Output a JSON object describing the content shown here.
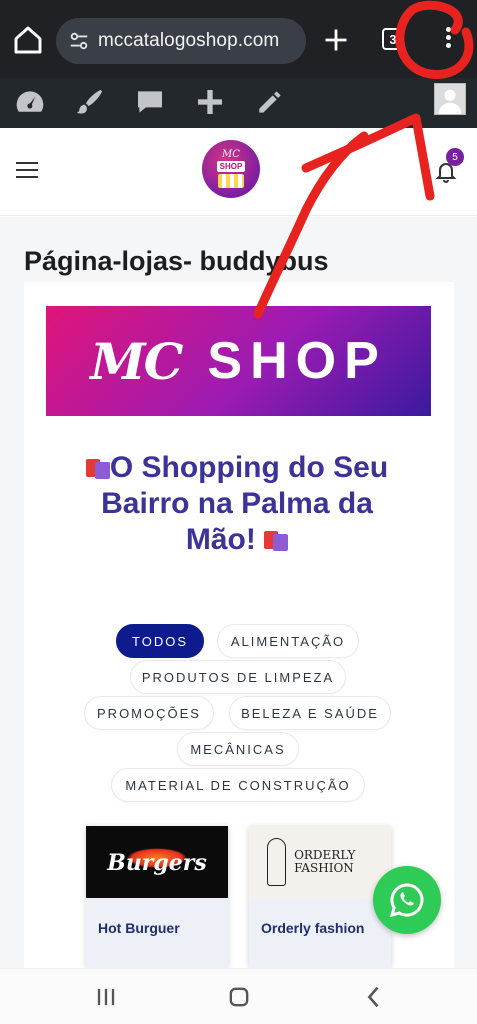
{
  "browser": {
    "url": "mccatalogoshop.com",
    "tab_count": "3",
    "icons": [
      "home-icon",
      "site-settings-icon",
      "plus-icon",
      "tabs-icon",
      "more-vert-icon"
    ]
  },
  "admin_bar": {
    "icons": [
      "dashboard-icon",
      "customize-brush-icon",
      "comments-icon",
      "new-content-icon",
      "edit-pencil-icon",
      "user-avatar"
    ]
  },
  "header": {
    "logo_mc": "MC",
    "logo_shop": "SHOP",
    "notification_count": "5"
  },
  "page": {
    "title": "Página-lojas- buddybus",
    "banner_mc": "MC",
    "banner_shop": "SHOP",
    "headline": "O Shopping do Seu Bairro na Palma da Mão!"
  },
  "filters": [
    {
      "label": "TODOS",
      "active": true
    },
    {
      "label": "ALIMENTAÇÃO",
      "active": false
    },
    {
      "label": "PRODUTOS DE LIMPEZA",
      "active": false
    },
    {
      "label": "PROMOÇÕES",
      "active": false
    },
    {
      "label": "BELEZA E SAÚDE",
      "active": false
    },
    {
      "label": "MECÂNICAS",
      "active": false
    },
    {
      "label": "MATERIAL DE CONSTRUÇÃO",
      "active": false
    }
  ],
  "stores": [
    {
      "name": "Hot Burguer",
      "logo_text": "Burgers"
    },
    {
      "name": "Orderly fashion",
      "logo_text": "ORDERLY FASHION"
    }
  ],
  "colors": {
    "browser_bar": "#1f2124",
    "admin_bar": "#23282d",
    "active_chip": "#0d1b8c",
    "headline": "#3b3397",
    "whatsapp": "#2ecc56",
    "annotation": "#e8231f"
  }
}
